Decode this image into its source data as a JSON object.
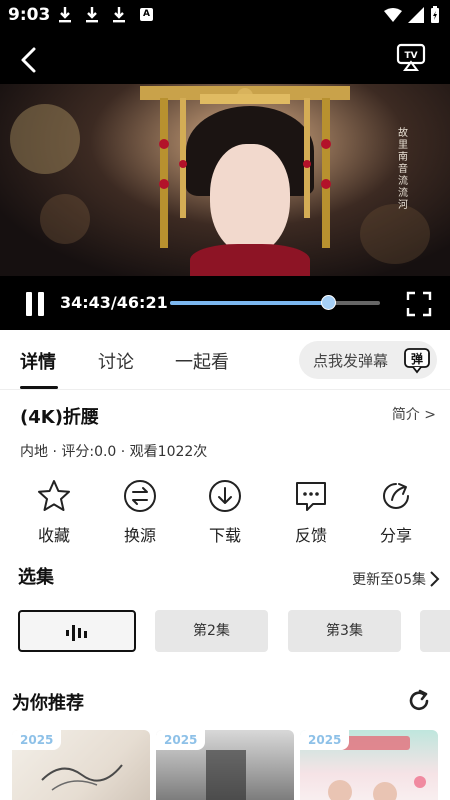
{
  "status_bar": {
    "time": "9:03",
    "a_badge": "A"
  },
  "player": {
    "current_time": "34:43",
    "total_time": "46:21",
    "time_display": "34:43/46:21",
    "progress_fraction": 0.75,
    "caption_text": "故里 南音 流流 河",
    "accent_color": "#7cb7ef"
  },
  "tabs": [
    {
      "label": "详情",
      "active": true
    },
    {
      "label": "讨论",
      "active": false
    },
    {
      "label": "一起看",
      "active": false
    }
  ],
  "danmu": {
    "placeholder": "点我发弹幕",
    "button_label": "弹"
  },
  "show": {
    "title": "(4K)折腰",
    "intro_link": "简介 >",
    "meta": "内地 · 评分:0.0 · 观看1022次"
  },
  "actions": [
    {
      "label": "收藏",
      "icon": "star-icon"
    },
    {
      "label": "换源",
      "icon": "swap-icon"
    },
    {
      "label": "下载",
      "icon": "download-icon"
    },
    {
      "label": "反馈",
      "icon": "feedback-icon"
    },
    {
      "label": "分享",
      "icon": "share-icon"
    }
  ],
  "episodes": {
    "section_title": "选集",
    "update_text": "更新至05集",
    "items": [
      {
        "label": "",
        "playing": true
      },
      {
        "label": "第2集",
        "playing": false
      },
      {
        "label": "第3集",
        "playing": false
      }
    ]
  },
  "recommend": {
    "section_title": "为你推荐",
    "cards": [
      {
        "year": "2025"
      },
      {
        "year": "2025"
      },
      {
        "year": "2025"
      }
    ]
  }
}
